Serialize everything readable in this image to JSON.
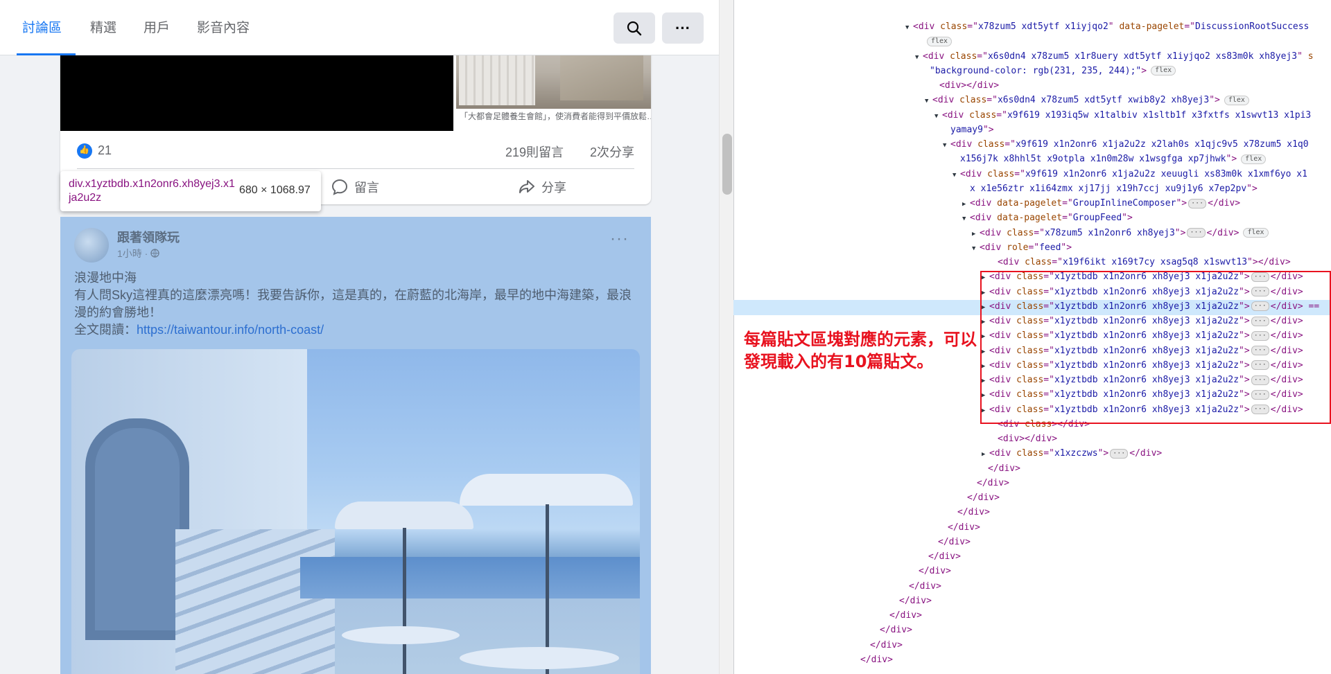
{
  "tabs": [
    {
      "label": "討論區",
      "active": true
    },
    {
      "label": "精選",
      "active": false
    },
    {
      "label": "用戶",
      "active": false
    },
    {
      "label": "影音內容",
      "active": false
    }
  ],
  "header_buttons": {
    "search_icon": "search-icon",
    "more_label": "···"
  },
  "post1": {
    "caption": "「大都會足體養生會館」，使消費者能得到平價放鬆…",
    "likes": "21",
    "comments": "219則留言",
    "shares": "2次分享",
    "actions": {
      "comment": "留言",
      "share": "分享"
    }
  },
  "tooltip": {
    "selector": "div.x1yztbdb.x1n2onr6.xh8yej3.x1ja2u2z",
    "size": "680 × 1068.97"
  },
  "post2": {
    "author": "跟著領隊玩",
    "time": "1小時 · ",
    "more": "···",
    "title": "浪漫地中海",
    "body": "有人問Sky這裡真的這麼漂亮嗎！我要告訴你，這是真的，在蔚藍的北海岸，最早的地中海建築，最浪漫的約會勝地！",
    "read_more_label": "全文閱讀：",
    "link": "https://taiwantour.info/north-coast/"
  },
  "collapsed_marker": "…",
  "devtools": {
    "lines": [
      {
        "indent": 248,
        "arrow": "▼",
        "parts": [
          [
            "tag",
            "<div "
          ],
          [
            "attr",
            "class"
          ],
          [
            "tag",
            "=\""
          ],
          [
            "val",
            "x78zum5 xdt5ytf x1iyjqo2"
          ],
          [
            "tag",
            "\" "
          ],
          [
            "attr",
            "data-pagelet"
          ],
          [
            "tag",
            "=\""
          ],
          [
            "val",
            "DiscussionRootSuccess"
          ]
        ]
      },
      {
        "indent": 262,
        "arrow": "",
        "parts": [],
        "badge": "flex"
      },
      {
        "indent": 262,
        "arrow": "▼",
        "parts": [
          [
            "tag",
            "<div "
          ],
          [
            "attr",
            "class"
          ],
          [
            "tag",
            "=\""
          ],
          [
            "val",
            "x6s0dn4 x78zum5 x1r8uery xdt5ytf x1iyjqo2 xs83m0k xh8yej3"
          ],
          [
            "tag",
            "\" "
          ],
          [
            "attr",
            "s"
          ]
        ]
      },
      {
        "indent": 272,
        "arrow": "",
        "parts": [
          [
            "val",
            "\"background-color: rgb(231, 235, 244);\""
          ],
          [
            "tag",
            ">"
          ]
        ],
        "badge": "flex"
      },
      {
        "indent": 286,
        "arrow": "",
        "parts": [
          [
            "tag",
            "<div></div>"
          ]
        ]
      },
      {
        "indent": 276,
        "arrow": "▼",
        "parts": [
          [
            "tag",
            "<div "
          ],
          [
            "attr",
            "class"
          ],
          [
            "tag",
            "=\""
          ],
          [
            "val",
            "x6s0dn4 x78zum5 xdt5ytf xwib8y2 xh8yej3"
          ],
          [
            "tag",
            "\">"
          ]
        ],
        "badge": "flex"
      },
      {
        "indent": 290,
        "arrow": "▼",
        "parts": [
          [
            "tag",
            "<div "
          ],
          [
            "attr",
            "class"
          ],
          [
            "tag",
            "=\""
          ],
          [
            "val",
            "x9f619 x193iq5w x1talbiv x1sltb1f x3fxtfs x1swvt13 x1pi3"
          ]
        ]
      },
      {
        "indent": 302,
        "arrow": "",
        "parts": [
          [
            "val",
            "yamay9"
          ],
          [
            "tag",
            "\">"
          ]
        ]
      },
      {
        "indent": 302,
        "arrow": "▼",
        "parts": [
          [
            "tag",
            "<div "
          ],
          [
            "attr",
            "class"
          ],
          [
            "tag",
            "=\""
          ],
          [
            "val",
            "x9f619 x1n2onr6 x1ja2u2z x2lah0s x1qjc9v5 x78zum5 x1q0"
          ]
        ]
      },
      {
        "indent": 316,
        "arrow": "",
        "parts": [
          [
            "val",
            "x156j7k x8hhl5t x9otpla x1n0m28w x1wsgfga xp7jhwk"
          ],
          [
            "tag",
            "\">"
          ]
        ],
        "badge": "flex"
      },
      {
        "indent": 316,
        "arrow": "▼",
        "parts": [
          [
            "tag",
            "<div "
          ],
          [
            "attr",
            "class"
          ],
          [
            "tag",
            "=\""
          ],
          [
            "val",
            "x9f619 x1n2onr6 x1ja2u2z xeuugli xs83m0k x1xmf6yo x1"
          ]
        ]
      },
      {
        "indent": 330,
        "arrow": "",
        "parts": [
          [
            "val",
            "x x1e56ztr x1i64zmx xj17jj x19h7ccj xu9j1y6 x7ep2pv"
          ],
          [
            "tag",
            "\">"
          ]
        ]
      },
      {
        "indent": 330,
        "arrow": "▶",
        "parts": [
          [
            "tag",
            "<div "
          ],
          [
            "attr",
            "data-pagelet"
          ],
          [
            "tag",
            "=\""
          ],
          [
            "val",
            "GroupInlineComposer"
          ],
          [
            "tag",
            "\">"
          ]
        ],
        "ell": true,
        "close": "</div>"
      },
      {
        "indent": 330,
        "arrow": "▼",
        "parts": [
          [
            "tag",
            "<div "
          ],
          [
            "attr",
            "data-pagelet"
          ],
          [
            "tag",
            "=\""
          ],
          [
            "val",
            "GroupFeed"
          ],
          [
            "tag",
            "\">"
          ]
        ]
      },
      {
        "indent": 344,
        "arrow": "▶",
        "parts": [
          [
            "tag",
            "<div "
          ],
          [
            "attr",
            "class"
          ],
          [
            "tag",
            "=\""
          ],
          [
            "val",
            "x78zum5 x1n2onr6 xh8yej3"
          ],
          [
            "tag",
            "\">"
          ]
        ],
        "ell": true,
        "close": "</div>",
        "badge": "flex"
      },
      {
        "indent": 344,
        "arrow": "▼",
        "parts": [
          [
            "tag",
            "<div "
          ],
          [
            "attr",
            "role"
          ],
          [
            "tag",
            "=\""
          ],
          [
            "val",
            "feed"
          ],
          [
            "tag",
            "\">"
          ]
        ]
      },
      {
        "indent": 370,
        "arrow": "",
        "parts": [
          [
            "tag",
            "<div "
          ],
          [
            "attr",
            "class"
          ],
          [
            "tag",
            "=\""
          ],
          [
            "val",
            "x19f6ikt x169t7cy xsag5q8 x1swvt13"
          ],
          [
            "tag",
            "\"></div>"
          ]
        ]
      },
      {
        "indent": 358,
        "arrow": "▶",
        "parts": [
          [
            "tag",
            "<div "
          ],
          [
            "attr",
            "class"
          ],
          [
            "tag",
            "=\""
          ],
          [
            "val",
            "x1yztbdb x1n2onr6 xh8yej3 x1ja2u2z"
          ],
          [
            "tag",
            "\">"
          ]
        ],
        "ell": true,
        "close": "</div>"
      },
      {
        "indent": 358,
        "arrow": "▶",
        "parts": [
          [
            "tag",
            "<div "
          ],
          [
            "attr",
            "class"
          ],
          [
            "tag",
            "=\""
          ],
          [
            "val",
            "x1yztbdb x1n2onr6 xh8yej3 x1ja2u2z"
          ],
          [
            "tag",
            "\">"
          ]
        ],
        "ell": true,
        "close": "</div>"
      },
      {
        "indent": 358,
        "arrow": "▶",
        "parts": [
          [
            "tag",
            "<div "
          ],
          [
            "attr",
            "class"
          ],
          [
            "tag",
            "=\""
          ],
          [
            "val",
            "x1yztbdb x1n2onr6 xh8yej3 x1ja2u2z"
          ],
          [
            "tag",
            "\">"
          ]
        ],
        "ell": true,
        "close": "</div> =="
      },
      {
        "indent": 358,
        "arrow": "▶",
        "parts": [
          [
            "tag",
            "<div "
          ],
          [
            "attr",
            "class"
          ],
          [
            "tag",
            "=\""
          ],
          [
            "val",
            "x1yztbdb x1n2onr6 xh8yej3 x1ja2u2z"
          ],
          [
            "tag",
            "\">"
          ]
        ],
        "ell": true,
        "close": "</div>"
      },
      {
        "indent": 358,
        "arrow": "▶",
        "parts": [
          [
            "tag",
            "<div "
          ],
          [
            "attr",
            "class"
          ],
          [
            "tag",
            "=\""
          ],
          [
            "val",
            "x1yztbdb x1n2onr6 xh8yej3 x1ja2u2z"
          ],
          [
            "tag",
            "\">"
          ]
        ],
        "ell": true,
        "close": "</div>"
      },
      {
        "indent": 358,
        "arrow": "▶",
        "parts": [
          [
            "tag",
            "<div "
          ],
          [
            "attr",
            "class"
          ],
          [
            "tag",
            "=\""
          ],
          [
            "val",
            "x1yztbdb x1n2onr6 xh8yej3 x1ja2u2z"
          ],
          [
            "tag",
            "\">"
          ]
        ],
        "ell": true,
        "close": "</div>"
      },
      {
        "indent": 358,
        "arrow": "▶",
        "parts": [
          [
            "tag",
            "<div "
          ],
          [
            "attr",
            "class"
          ],
          [
            "tag",
            "=\""
          ],
          [
            "val",
            "x1yztbdb x1n2onr6 xh8yej3 x1ja2u2z"
          ],
          [
            "tag",
            "\">"
          ]
        ],
        "ell": true,
        "close": "</div>"
      },
      {
        "indent": 358,
        "arrow": "▶",
        "parts": [
          [
            "tag",
            "<div "
          ],
          [
            "attr",
            "class"
          ],
          [
            "tag",
            "=\""
          ],
          [
            "val",
            "x1yztbdb x1n2onr6 xh8yej3 x1ja2u2z"
          ],
          [
            "tag",
            "\">"
          ]
        ],
        "ell": true,
        "close": "</div>"
      },
      {
        "indent": 358,
        "arrow": "▶",
        "parts": [
          [
            "tag",
            "<div "
          ],
          [
            "attr",
            "class"
          ],
          [
            "tag",
            "=\""
          ],
          [
            "val",
            "x1yztbdb x1n2onr6 xh8yej3 x1ja2u2z"
          ],
          [
            "tag",
            "\">"
          ]
        ],
        "ell": true,
        "close": "</div>"
      },
      {
        "indent": 358,
        "arrow": "▶",
        "parts": [
          [
            "tag",
            "<div "
          ],
          [
            "attr",
            "class"
          ],
          [
            "tag",
            "=\""
          ],
          [
            "val",
            "x1yztbdb x1n2onr6 xh8yej3 x1ja2u2z"
          ],
          [
            "tag",
            "\">"
          ]
        ],
        "ell": true,
        "close": "</div>"
      },
      {
        "indent": 370,
        "arrow": "",
        "parts": [
          [
            "tag",
            "<div "
          ],
          [
            "attr",
            "class"
          ],
          [
            "tag",
            "></div>"
          ]
        ]
      },
      {
        "indent": 370,
        "arrow": "",
        "parts": [
          [
            "tag",
            "<div></div>"
          ]
        ]
      },
      {
        "indent": 358,
        "arrow": "▶",
        "parts": [
          [
            "tag",
            "<div "
          ],
          [
            "attr",
            "class"
          ],
          [
            "tag",
            "=\""
          ],
          [
            "val",
            "x1xzczws"
          ],
          [
            "tag",
            "\">"
          ]
        ],
        "ell": true,
        "close": "</div>"
      },
      {
        "indent": 356,
        "arrow": "",
        "parts": [
          [
            "tag",
            "</div>"
          ]
        ]
      },
      {
        "indent": 340,
        "arrow": "",
        "parts": [
          [
            "tag",
            "</div>"
          ]
        ]
      },
      {
        "indent": 326,
        "arrow": "",
        "parts": [
          [
            "tag",
            "</div>"
          ]
        ]
      },
      {
        "indent": 312,
        "arrow": "",
        "parts": [
          [
            "tag",
            "</div>"
          ]
        ]
      },
      {
        "indent": 298,
        "arrow": "",
        "parts": [
          [
            "tag",
            "</div>"
          ]
        ]
      },
      {
        "indent": 284,
        "arrow": "",
        "parts": [
          [
            "tag",
            "</div>"
          ]
        ]
      },
      {
        "indent": 270,
        "arrow": "",
        "parts": [
          [
            "tag",
            "</div>"
          ]
        ]
      },
      {
        "indent": 256,
        "arrow": "",
        "parts": [
          [
            "tag",
            "</div>"
          ]
        ]
      },
      {
        "indent": 242,
        "arrow": "",
        "parts": [
          [
            "tag",
            "</div>"
          ]
        ]
      },
      {
        "indent": 228,
        "arrow": "",
        "parts": [
          [
            "tag",
            "</div>"
          ]
        ]
      },
      {
        "indent": 214,
        "arrow": "",
        "parts": [
          [
            "tag",
            "</div>"
          ]
        ]
      },
      {
        "indent": 200,
        "arrow": "",
        "parts": [
          [
            "tag",
            "</div>"
          ]
        ]
      },
      {
        "indent": 186,
        "arrow": "",
        "parts": [
          [
            "tag",
            "</div>"
          ]
        ]
      },
      {
        "indent": 172,
        "arrow": "",
        "parts": [
          [
            "tag",
            "</div>"
          ]
        ]
      }
    ]
  },
  "annotation": "每篇貼文區塊對應的元素，可以發現載入的有10篇貼文。",
  "colors": {
    "accent": "#1877f2",
    "highlight": "#a4c5ea",
    "annotation": "#e8121f"
  }
}
